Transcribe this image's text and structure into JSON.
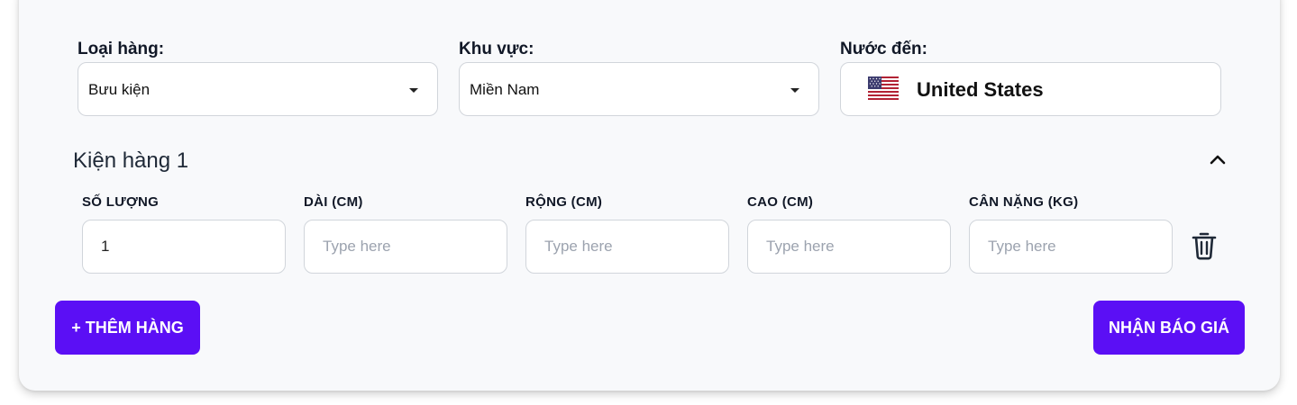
{
  "form": {
    "cargo_type": {
      "label": "Loại hàng:",
      "value": "Bưu kiện"
    },
    "region": {
      "label": "Khu vực:",
      "value": "Miền Nam"
    },
    "destination": {
      "label": "Nước đến:",
      "value": "United States",
      "flag_icon": "us-flag-icon"
    }
  },
  "package": {
    "title": "Kiện hàng 1",
    "columns": {
      "quantity": {
        "label": "SỐ LƯỢNG",
        "value": "1",
        "placeholder": ""
      },
      "length": {
        "label": "DÀI (CM)",
        "value": "",
        "placeholder": "Type here"
      },
      "width": {
        "label": "RỘNG (CM)",
        "value": "",
        "placeholder": "Type here"
      },
      "height": {
        "label": "CAO (CM)",
        "value": "",
        "placeholder": "Type here"
      },
      "weight": {
        "label": "CÂN NẶNG (KG)",
        "value": "",
        "placeholder": "Type here"
      }
    }
  },
  "actions": {
    "add_label": "+ THÊM HÀNG",
    "quote_label": "NHẬN BÁO GIÁ"
  },
  "colors": {
    "accent": "#5b0ff5",
    "card_bg": "#f8f9fb",
    "border": "#d1d5db"
  }
}
